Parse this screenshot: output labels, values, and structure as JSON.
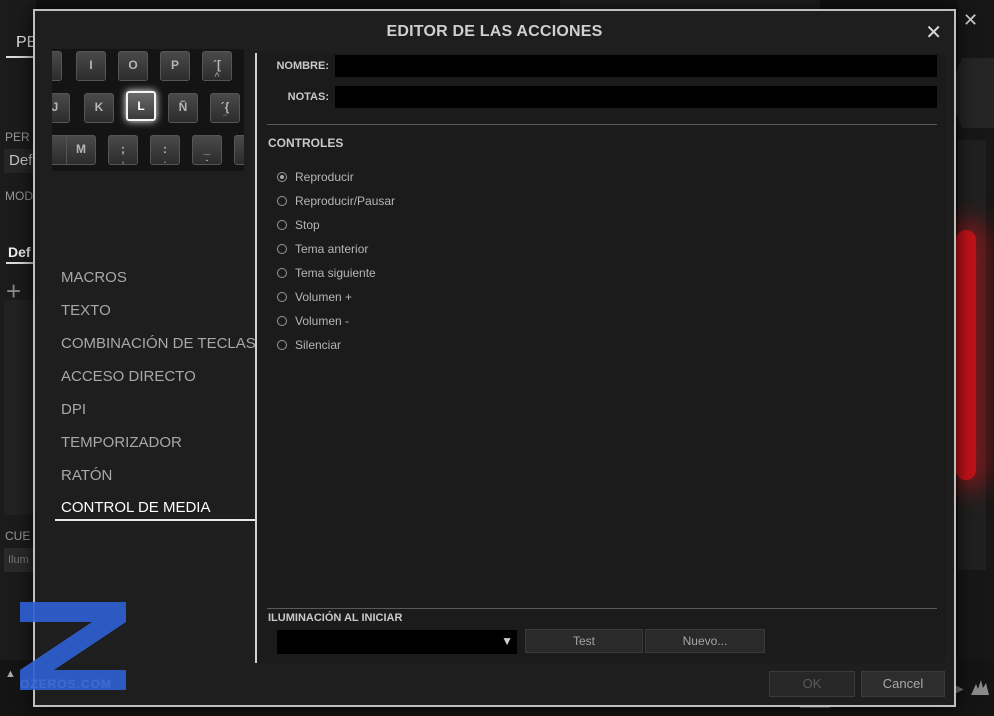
{
  "background": {
    "tab_label": "PE",
    "profile_label": "PER",
    "profile_value": "Def",
    "mode_label": "MOD",
    "mode_value": "Def",
    "cue_label": "CUE",
    "cue_value": "Ilum"
  },
  "modal": {
    "title": "EDITOR DE LAS ACCIONES",
    "close_label": "✕"
  },
  "keyboard": {
    "row1": [
      {
        "label": "I",
        "sub": ""
      },
      {
        "label": "O",
        "sub": ""
      },
      {
        "label": "P",
        "sub": ""
      },
      {
        "label": "´[",
        "sub": "^"
      }
    ],
    "row2": [
      {
        "label": "J",
        "sub": ""
      },
      {
        "label": "K",
        "sub": ""
      },
      {
        "label": "L",
        "sub": ""
      },
      {
        "label": "Ñ",
        "sub": ""
      },
      {
        "label": "´{",
        "sub": "¨"
      }
    ],
    "row3": [
      {
        "label": "M",
        "sub": ""
      },
      {
        "label": ";",
        "sub": ","
      },
      {
        "label": ":",
        "sub": "."
      },
      {
        "label": "_",
        "sub": "-"
      }
    ],
    "selected_key": "L"
  },
  "menu": {
    "items": [
      {
        "label": "MACROS"
      },
      {
        "label": "TEXTO"
      },
      {
        "label": "COMBINACIÓN DE TECLAS"
      },
      {
        "label": "ACCESO DIRECTO"
      },
      {
        "label": "DPI"
      },
      {
        "label": "TEMPORIZADOR"
      },
      {
        "label": "RATÓN"
      },
      {
        "label": "CONTROL DE MEDIA"
      }
    ],
    "active": "CONTROL DE MEDIA"
  },
  "form": {
    "name_label": "NOMBRE:",
    "name_value": "",
    "notes_label": "NOTAS:",
    "notes_value": ""
  },
  "controls": {
    "title": "CONTROLES",
    "options": [
      {
        "label": "Reproducir",
        "selected": true
      },
      {
        "label": "Reproducir/Pausar",
        "selected": false
      },
      {
        "label": "Stop",
        "selected": false
      },
      {
        "label": "Tema anterior",
        "selected": false
      },
      {
        "label": "Tema siguiente",
        "selected": false
      },
      {
        "label": "Volumen +",
        "selected": false
      },
      {
        "label": "Volumen -",
        "selected": false
      },
      {
        "label": "Silenciar",
        "selected": false
      }
    ]
  },
  "lighting": {
    "title": "ILUMINACIÓN AL INICIAR",
    "selected_value": "",
    "test_label": "Test",
    "new_label": "Nuevo..."
  },
  "footer": {
    "ok_label": "OK",
    "cancel_label": "Cancel"
  },
  "watermark": {
    "text": "OZEROS.COM",
    "color": "#2f5fd0"
  },
  "colors": {
    "accent_red": "#c2121a",
    "modal_bg": "#1e1e1e"
  }
}
